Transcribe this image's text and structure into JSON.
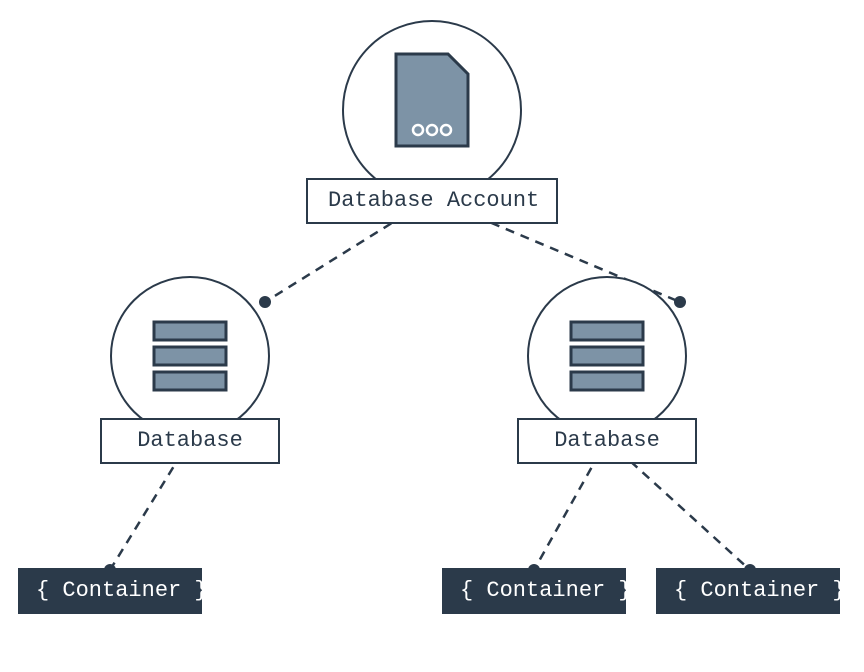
{
  "diagram": {
    "root": {
      "label": "Database Account"
    },
    "databases": [
      {
        "label": "Database"
      },
      {
        "label": "Database"
      }
    ],
    "containers": [
      {
        "label": "{ Container }"
      },
      {
        "label": "{ Container }"
      },
      {
        "label": "{ Container }"
      }
    ],
    "colors": {
      "stroke": "#2b3a4a",
      "fill_muted": "#7d93a6",
      "container_bg": "#2b3a4a",
      "container_fg": "#ffffff"
    }
  }
}
